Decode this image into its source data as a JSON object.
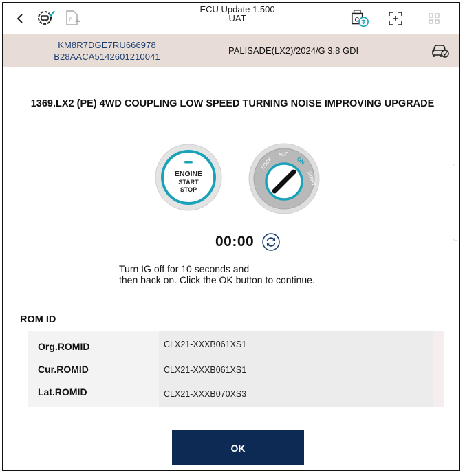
{
  "header": {
    "title_line1": "ECU Update 1.500",
    "title_line2": "UAT"
  },
  "vehicle": {
    "vin_line1": "KM8R7DGE7RU666978",
    "vin_line2": "B28AACA5142601210041",
    "model": "PALISADE(LX2)/2024/G 3.8 GDI"
  },
  "main": {
    "heading": "1369.LX2 (PE) 4WD COUPLING LOW SPEED TURNING NOISE IMPROVING UPGRADE",
    "engine_button": {
      "line1": "ENGINE",
      "line2": "START",
      "line3": "STOP"
    },
    "ignition_labels": {
      "lock": "LOCK",
      "acc": "ACC",
      "on": "ON",
      "start": "START"
    },
    "timer": "00:00",
    "instruction_line1": "Turn IG off for 10 seconds and",
    "instruction_line2": "then back on. Click the OK button to continue."
  },
  "romid": {
    "title": "ROM ID",
    "rows": [
      {
        "label": "Org.ROMID",
        "value": "CLX21-XXXB061XS1"
      },
      {
        "label": "Cur.ROMID",
        "value": "CLX21-XXXB061XS1"
      },
      {
        "label": "Lat.ROMID",
        "value": "CLX21-XXXB070XS3"
      }
    ]
  },
  "footer": {
    "ok_label": "OK"
  },
  "colors": {
    "accent": "#1aa3b8",
    "button": "#0d2a55",
    "vehicle_bar": "#e8ddd6",
    "vin_text": "#1b3f73"
  },
  "icons": [
    "back-icon",
    "vehicle-settings-icon",
    "e-document-icon",
    "vci-wireless-icon",
    "capture-icon",
    "grid-menu-icon",
    "vehicle-check-icon",
    "refresh-icon"
  ]
}
